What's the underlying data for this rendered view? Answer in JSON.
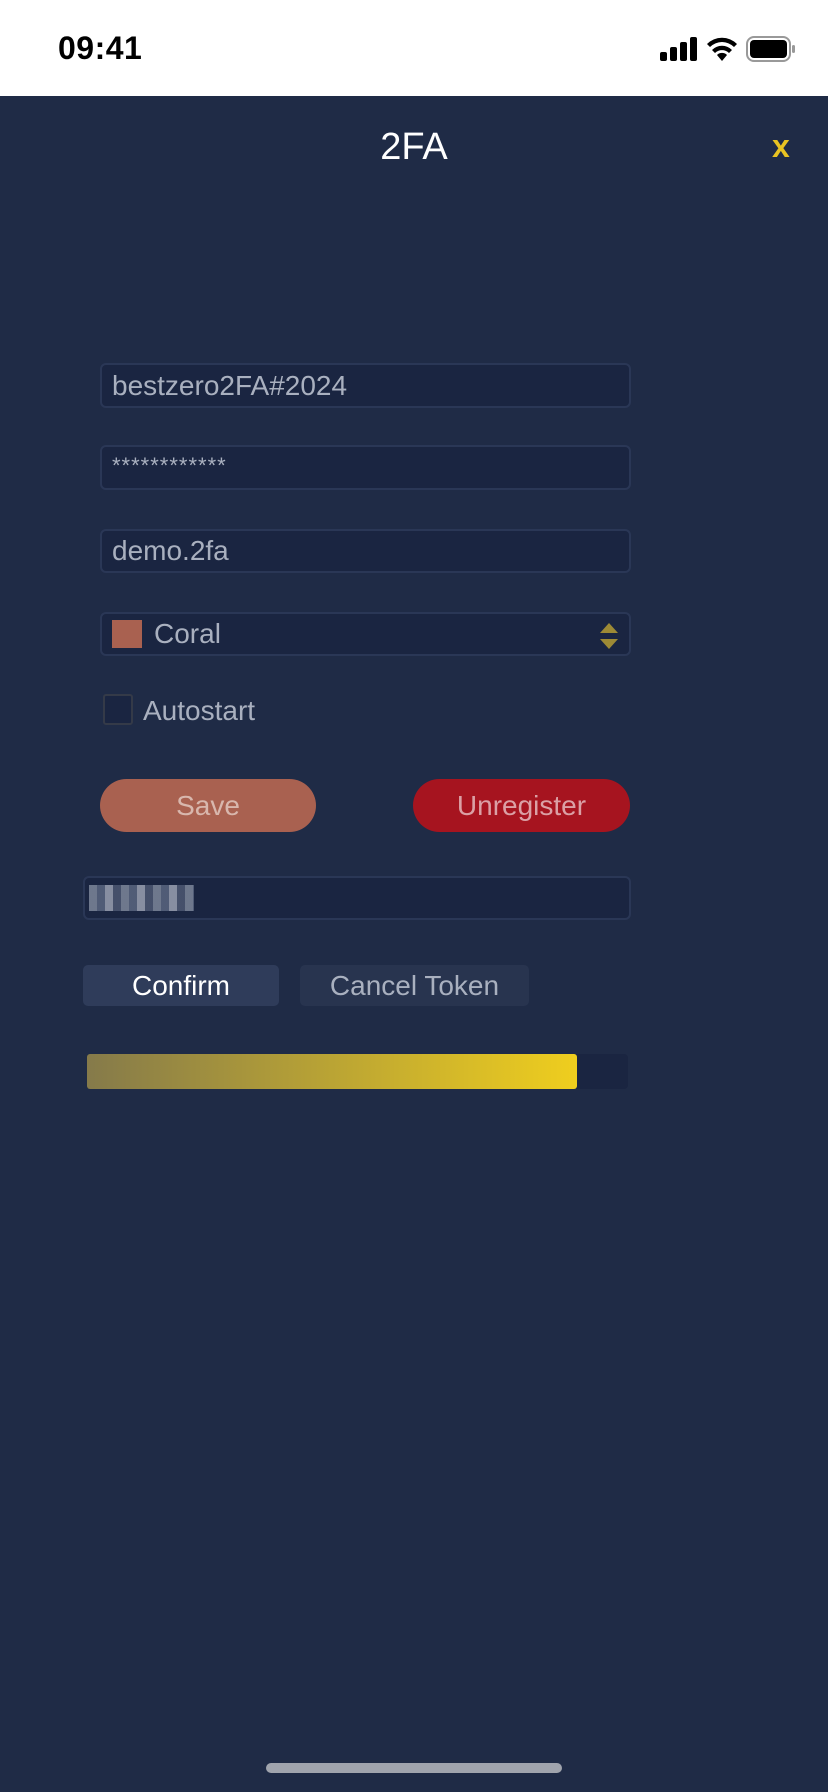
{
  "status_bar": {
    "time": "09:41",
    "icons": [
      "signal-icon",
      "wifi-icon",
      "battery-icon"
    ]
  },
  "header": {
    "title": "2FA",
    "close_icon": "close-icon",
    "close_label": "x"
  },
  "form": {
    "secret_value": "bestzero2FA#2024",
    "password_value": "************",
    "account_value": "demo.2fa",
    "color_select": {
      "selected": "Coral",
      "swatch_color": "#a96150"
    },
    "autostart": {
      "label": "Autostart",
      "checked": false
    },
    "save_label": "Save",
    "unregister_label": "Unregister"
  },
  "token": {
    "value_obscured": true,
    "confirm_label": "Confirm",
    "cancel_label": "Cancel Token",
    "progress_fraction": 0.905
  },
  "colors": {
    "background": "#1f2b46",
    "accent": "#e8c322",
    "save": "#a96150",
    "unregister": "#a6141f"
  }
}
